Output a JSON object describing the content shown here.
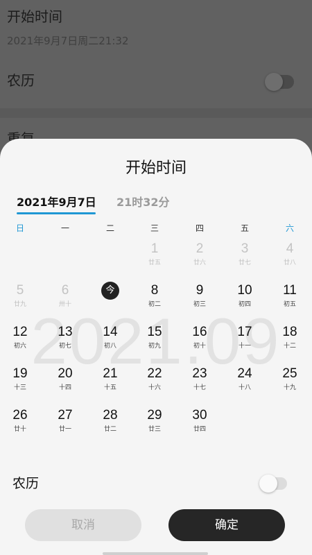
{
  "background": {
    "title": "开始时间",
    "datetime": "2021年9月7日周二21:32",
    "lunar_label": "农历",
    "repeat_label": "重复"
  },
  "sheet": {
    "title": "开始时间",
    "tabs": {
      "date": "2021年9月7日",
      "time": "21时32分"
    },
    "weekdays": [
      "日",
      "一",
      "二",
      "三",
      "四",
      "五",
      "六"
    ],
    "watermark": "2021.09",
    "today_glyph": "今",
    "days": [
      {
        "num": "1",
        "lunar": "廿五",
        "dim": true
      },
      {
        "num": "2",
        "lunar": "廿六",
        "dim": true
      },
      {
        "num": "3",
        "lunar": "廿七",
        "dim": true
      },
      {
        "num": "4",
        "lunar": "廿八",
        "dim": true
      },
      {
        "num": "5",
        "lunar": "廿九",
        "dim": true
      },
      {
        "num": "6",
        "lunar": "卅十",
        "dim": true
      },
      {
        "num": "7",
        "lunar": "",
        "today": true
      },
      {
        "num": "8",
        "lunar": "初二"
      },
      {
        "num": "9",
        "lunar": "初三"
      },
      {
        "num": "10",
        "lunar": "初四"
      },
      {
        "num": "11",
        "lunar": "初五"
      },
      {
        "num": "12",
        "lunar": "初六"
      },
      {
        "num": "13",
        "lunar": "初七"
      },
      {
        "num": "14",
        "lunar": "初八"
      },
      {
        "num": "15",
        "lunar": "初九"
      },
      {
        "num": "16",
        "lunar": "初十"
      },
      {
        "num": "17",
        "lunar": "十一"
      },
      {
        "num": "18",
        "lunar": "十二"
      },
      {
        "num": "19",
        "lunar": "十三"
      },
      {
        "num": "20",
        "lunar": "十四"
      },
      {
        "num": "21",
        "lunar": "十五"
      },
      {
        "num": "22",
        "lunar": "十六"
      },
      {
        "num": "23",
        "lunar": "十七"
      },
      {
        "num": "24",
        "lunar": "十八"
      },
      {
        "num": "25",
        "lunar": "十九"
      },
      {
        "num": "26",
        "lunar": "廿十"
      },
      {
        "num": "27",
        "lunar": "廿一"
      },
      {
        "num": "28",
        "lunar": "廿二"
      },
      {
        "num": "29",
        "lunar": "廿三"
      },
      {
        "num": "30",
        "lunar": "廿四"
      }
    ],
    "lunar_setting_label": "农历",
    "cancel_label": "取消",
    "confirm_label": "确定",
    "accent_color": "#1f97d4"
  }
}
